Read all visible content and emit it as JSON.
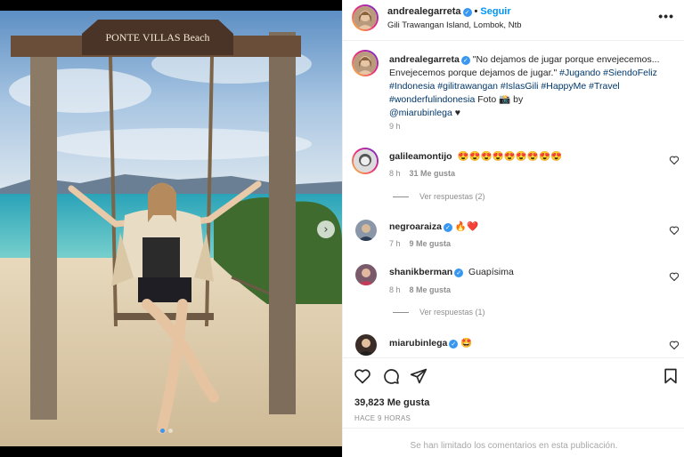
{
  "photo": {
    "sign_text": "PONTE VILLAS  Beach",
    "next_icon": "chevron-right-icon",
    "carousel_count": 2,
    "carousel_active": 0
  },
  "header": {
    "username": "andrealegarreta",
    "separator": "•",
    "follow_label": "Seguir",
    "location": "Gili Trawangan Island, Lombok, Ntb",
    "more_icon": "more-options-icon",
    "more_label": "•••"
  },
  "caption": {
    "username": "andrealegarreta",
    "text": "\"No dejamos de jugar porque envejecemos... Envejecemos porque dejamos de jugar.\"",
    "hashtags": "#Jugando #SiendoFeliz #Indonesia #gilitrawangan #IslasGili #HappyMe #Travel #wonderfulindonesia",
    "suffix": "Foto 📸 by",
    "mention": "@miarubinlega",
    "heart": "♥",
    "time": "9 h"
  },
  "comments": [
    {
      "username": "galileamontijo",
      "verified": false,
      "text": "😍😍😍😍😍😍😍😍😍",
      "time": "8 h",
      "likes": "31 Me gusta",
      "replies": "Ver respuestas (2)"
    },
    {
      "username": "negroaraiza",
      "verified": true,
      "text": "🔥❤️",
      "time": "7 h",
      "likes": "9 Me gusta",
      "replies": ""
    },
    {
      "username": "shanikberman",
      "verified": true,
      "text": "Guapísima",
      "time": "8 h",
      "likes": "8 Me gusta",
      "replies": "Ver respuestas (1)"
    },
    {
      "username": "miarubinlega",
      "verified": true,
      "text": "🤩",
      "time": "",
      "likes": "",
      "replies": ""
    }
  ],
  "actions": {
    "icons": [
      "heart-icon",
      "comment-icon",
      "share-icon",
      "bookmark-icon"
    ],
    "likes": "39,823 Me gusta",
    "posted": "HACE 9 HORAS",
    "comments_limited": "Se han limitado los comentarios en esta publicación."
  },
  "colors": {
    "link_blue": "#0095f6",
    "hashtag": "#00376b",
    "muted": "#8e8e8e",
    "verified": "#3897f0"
  }
}
